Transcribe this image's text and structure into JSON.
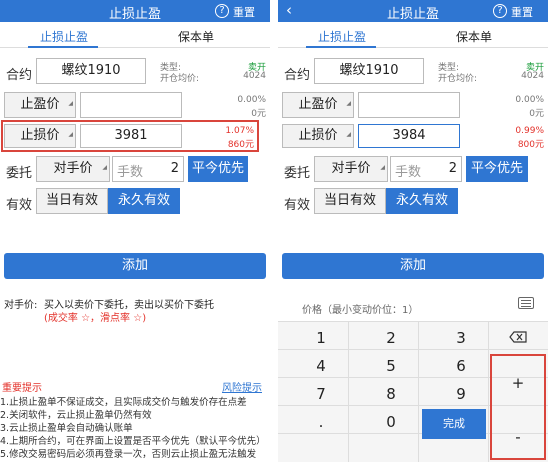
{
  "left": {
    "title": "止损止盈",
    "help": "?",
    "reset": "重置",
    "tabs": [
      "止损止盈",
      "保本单"
    ],
    "contract_label": "合约",
    "contract": "螺纹1910",
    "type_label": "类型:",
    "type_value": "卖开",
    "open_label": "开仓均价:",
    "open_value": "4024",
    "tp_label": "止盈价",
    "tp_pct": "0.00%",
    "tp_amt": "0元",
    "sl_label": "止损价",
    "sl_value": "3981",
    "sl_pct": "1.07%",
    "sl_amt": "860元",
    "order_label": "委托",
    "order_type": "对手价",
    "qty_label": "手数",
    "qty": "2",
    "priority": "平今优先",
    "valid_label": "有效",
    "valid_day": "当日有效",
    "valid_perm": "永久有效",
    "add": "添加",
    "note_key": "对手价:",
    "note_text": "买入以卖价下委托，卖出以买价下委托",
    "note_sub": "(成交率 ☆，滑点率 ☆)",
    "warn_title": "重要提示",
    "warn_link": "风险提示",
    "warn_lines": [
      "1.止损止盈单不保证成交，且实际成交价与触发价存在点差",
      "2.关闭软件，云止损止盈单仍然有效",
      "3.云止损止盈单会自动确认账单",
      "4.上期所合约，可在界面上设置是否平今优先（默认平今优先）",
      "5.修改交易密码后必须再登录一次，否则云止损止盈无法触发"
    ]
  },
  "right": {
    "title": "止损止盈",
    "help": "?",
    "reset": "重置",
    "tabs": [
      "止损止盈",
      "保本单"
    ],
    "contract_label": "合约",
    "contract": "螺纹1910",
    "type_label": "类型:",
    "type_value": "卖开",
    "open_label": "开仓均价:",
    "open_value": "4024",
    "tp_label": "止盈价",
    "tp_pct": "0.00%",
    "tp_amt": "0元",
    "sl_label": "止损价",
    "sl_value": "3984",
    "sl_pct": "0.99%",
    "sl_amt": "800元",
    "order_label": "委托",
    "order_type": "对手价",
    "qty_label": "手数",
    "qty": "2",
    "priority": "平今优先",
    "valid_label": "有效",
    "valid_day": "当日有效",
    "valid_perm": "永久有效",
    "add": "添加",
    "price_hint": "价格（最小变动价位：1）",
    "keys": {
      "k1": "1",
      "k2": "2",
      "k3": "3",
      "k4": "4",
      "k5": "5",
      "k6": "6",
      "k7": "7",
      "k8": "8",
      "k9": "9",
      "dot": ".",
      "k0": "0",
      "done": "完成",
      "plus": "+",
      "minus": "-"
    }
  },
  "colors": {
    "accent": "#2f76d2",
    "danger": "#d9453c",
    "gain": "#1a9c3b"
  }
}
